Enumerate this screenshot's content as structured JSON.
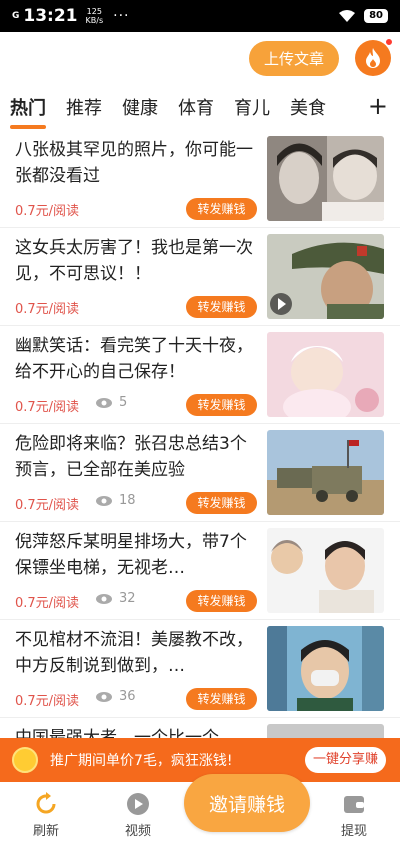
{
  "status_bar": {
    "signal": "G",
    "time": "13:21",
    "speed_value": "125",
    "speed_unit": "KB/s",
    "dots": "···",
    "battery": "80"
  },
  "header": {
    "upload_label": "上传文章"
  },
  "tabs": [
    {
      "label": "热门",
      "active": true
    },
    {
      "label": "推荐"
    },
    {
      "label": "健康"
    },
    {
      "label": "体育"
    },
    {
      "label": "育儿"
    },
    {
      "label": "美食"
    }
  ],
  "tab_add": "+",
  "articles": [
    {
      "title": "八张极其罕见的照片，你可能一张都没看过",
      "price": "0.7元/阅读",
      "views": "",
      "share": "转发赚钱"
    },
    {
      "title": "这女兵太厉害了！我也是第一次见，不可思议！！",
      "price": "0.7元/阅读",
      "views": "",
      "share": "转发赚钱"
    },
    {
      "title": "幽默笑话：看完笑了十天十夜，给不开心的自己保存！",
      "price": "0.7元/阅读",
      "views": "5",
      "share": "转发赚钱"
    },
    {
      "title": "危险即将来临？张召忠总结3个预言，已全部在美应验",
      "price": "0.7元/阅读",
      "views": "18",
      "share": "转发赚钱"
    },
    {
      "title": "倪萍怒斥某明星排场大，带7个保镖坐电梯，无视老…",
      "price": "0.7元/阅读",
      "views": "32",
      "share": "转发赚钱"
    },
    {
      "title": "不见棺材不流泪！美屡教不改，中方反制说到做到，…",
      "price": "0.7元/阅读",
      "views": "36",
      "share": "转发赚钱"
    },
    {
      "title": "中国最强大者，一个比一个",
      "price": "",
      "views": "",
      "share": ""
    }
  ],
  "promo": {
    "text": "推广期间单价7毛，疯狂涨钱!",
    "button": "一键分享赚"
  },
  "bottom_nav": {
    "refresh": "刷新",
    "video": "视频",
    "invite": "邀请赚钱",
    "withdraw": "提现"
  },
  "colors": {
    "accent": "#f57a1f",
    "price": "#e0544b",
    "promo": "#f56a1c",
    "upload": "#f7a23a"
  }
}
